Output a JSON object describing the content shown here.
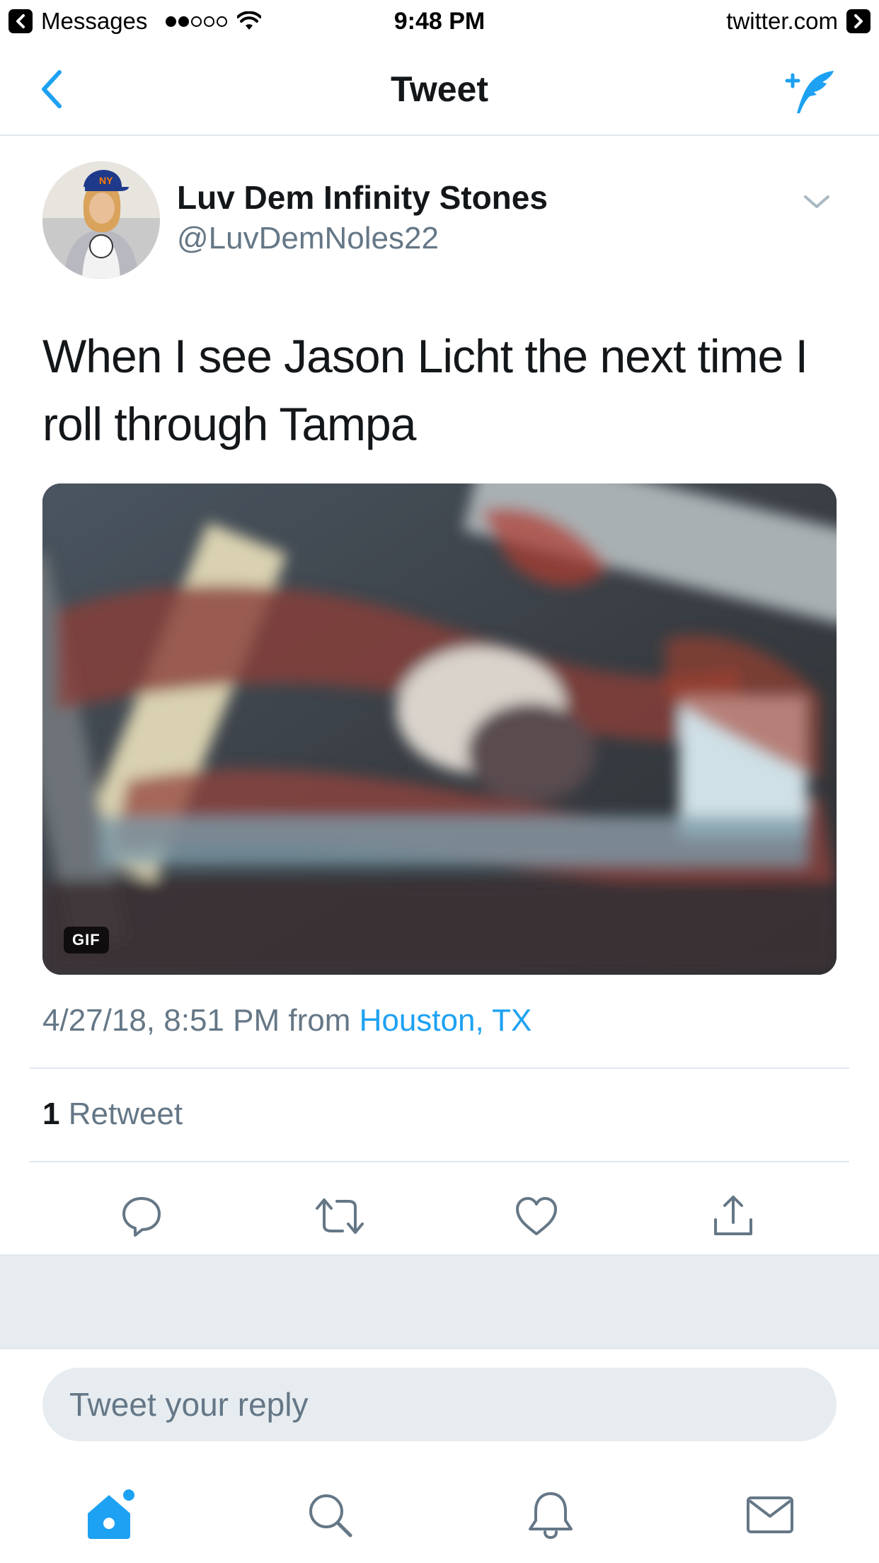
{
  "status_bar": {
    "back_app": "Messages",
    "time": "9:48 PM",
    "forward_site": "twitter.com"
  },
  "nav": {
    "title": "Tweet"
  },
  "tweet": {
    "author_name": "Luv Dem Infinity Stones",
    "author_handle": "@LuvDemNoles22",
    "text": "When I see Jason Licht the next time I roll through Tampa",
    "media_badge": "GIF",
    "timestamp": "4/27/18, 8:51 PM",
    "from_label": "from",
    "location": "Houston, TX",
    "retweet_count": "1",
    "retweet_label": "Retweet"
  },
  "actions": {
    "icons": [
      "reply-icon",
      "retweet-icon",
      "like-icon",
      "share-icon"
    ]
  },
  "reply": {
    "placeholder": "Tweet your reply"
  },
  "tab_bar": {
    "icons": [
      "home-icon",
      "search-icon",
      "notifications-icon",
      "messages-icon"
    ]
  },
  "colors": {
    "accent": "#1da1f2",
    "secondary_text": "#657786",
    "divider": "#e1e8ed",
    "band": "#e6ecf0"
  }
}
